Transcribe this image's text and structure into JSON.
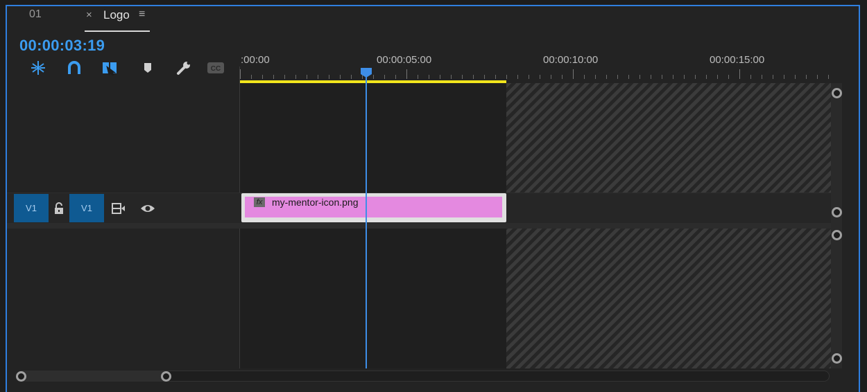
{
  "tabs": {
    "sequence_tab": "01",
    "active_tab": {
      "close": "×",
      "label": "Logo",
      "menu": "≡"
    }
  },
  "timecode": "00:00:03:19",
  "toolbar": {
    "icons": [
      "insert-nest-icon",
      "snap-magnet-icon",
      "linked-selection-icon",
      "add-marker-icon",
      "wrench-settings-icon",
      "captions-icon"
    ],
    "captions_label": "CC"
  },
  "ruler": {
    "labels": [
      ":00:00",
      "00:00:05:00",
      "00:00:10:00",
      "00:00:15:00"
    ],
    "playhead_time": "00:00:03:19"
  },
  "track": {
    "source_label": "V1",
    "target_label": "V1"
  },
  "clip": {
    "fx_label": "fx",
    "name": "my-mentor-icon.png"
  },
  "colors": {
    "accent": "#3b9cf0",
    "frame": "#2f7fe0",
    "work_area": "#f1e51c",
    "clip": "#e489e0",
    "track_target": "#0f5a92"
  }
}
